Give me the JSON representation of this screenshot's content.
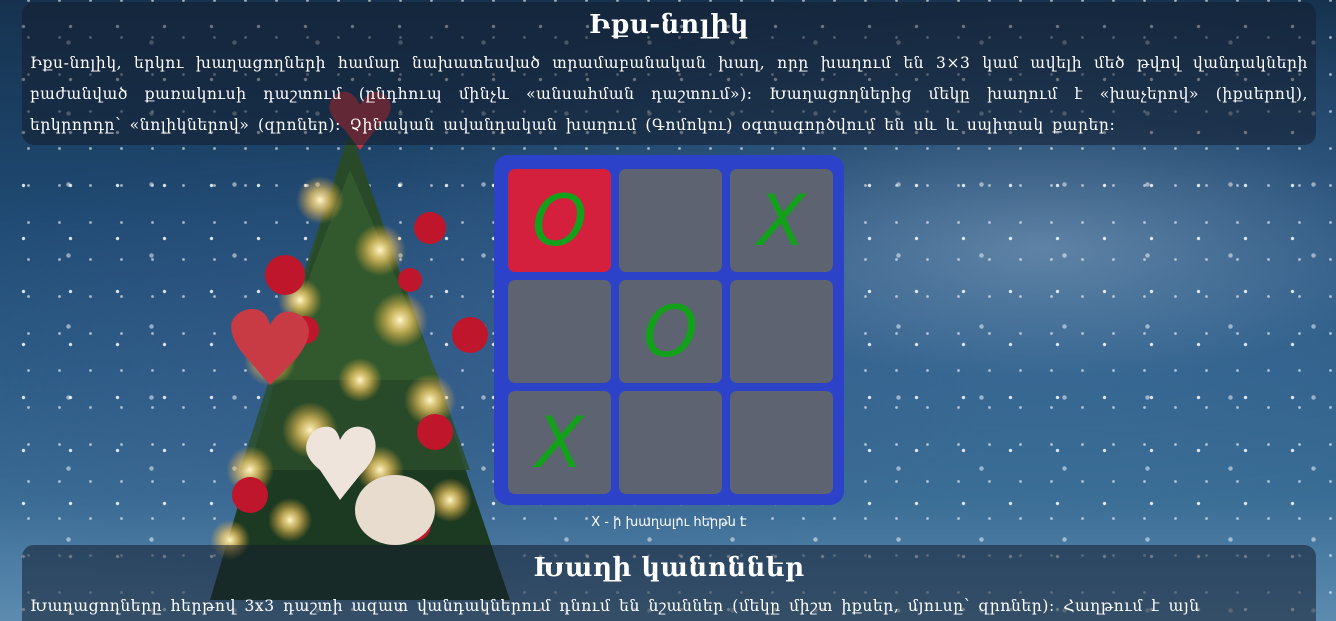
{
  "intro": {
    "title": "Իքս-նոլիկ",
    "text": "Իքս-նոլիկ, երկու խաղացողների համար նախատեսված տրամաբանական խաղ, որը խաղում են 3×3 կամ ավելի մեծ թվով վանդակների բաժանված քառակուսի դաշտում (ընդհուպ մինչև «անսահման դաշտում»): Խաղացողներից մեկը խաղում է «խաչերով» (իքսերով), երկրորդը՝ «նոլիկներով» (զրոներ)։ Չինական ավանդական խաղում (Գոմոկու) օգտագործվում են սև և սպիտակ քարեր։"
  },
  "board": {
    "cells": [
      "O",
      "",
      "X",
      "",
      "O",
      "",
      "X",
      "",
      ""
    ],
    "highlight_index": 0,
    "colors": {
      "frame": "#2c42c9",
      "cell": "#5d6370",
      "highlight": "#d4203c",
      "mark": "#13a01b"
    }
  },
  "status": "X - ի խաղալու հերթն է",
  "rules": {
    "title": "Խաղի կանոններ",
    "text": "Խաղացողները հերթով 3x3 դաշտի ազատ վանդակներում դնում են նշաններ (մեկը միշտ իքսեր, մյուսը՝ զրոներ): Հաղթում է այն"
  }
}
